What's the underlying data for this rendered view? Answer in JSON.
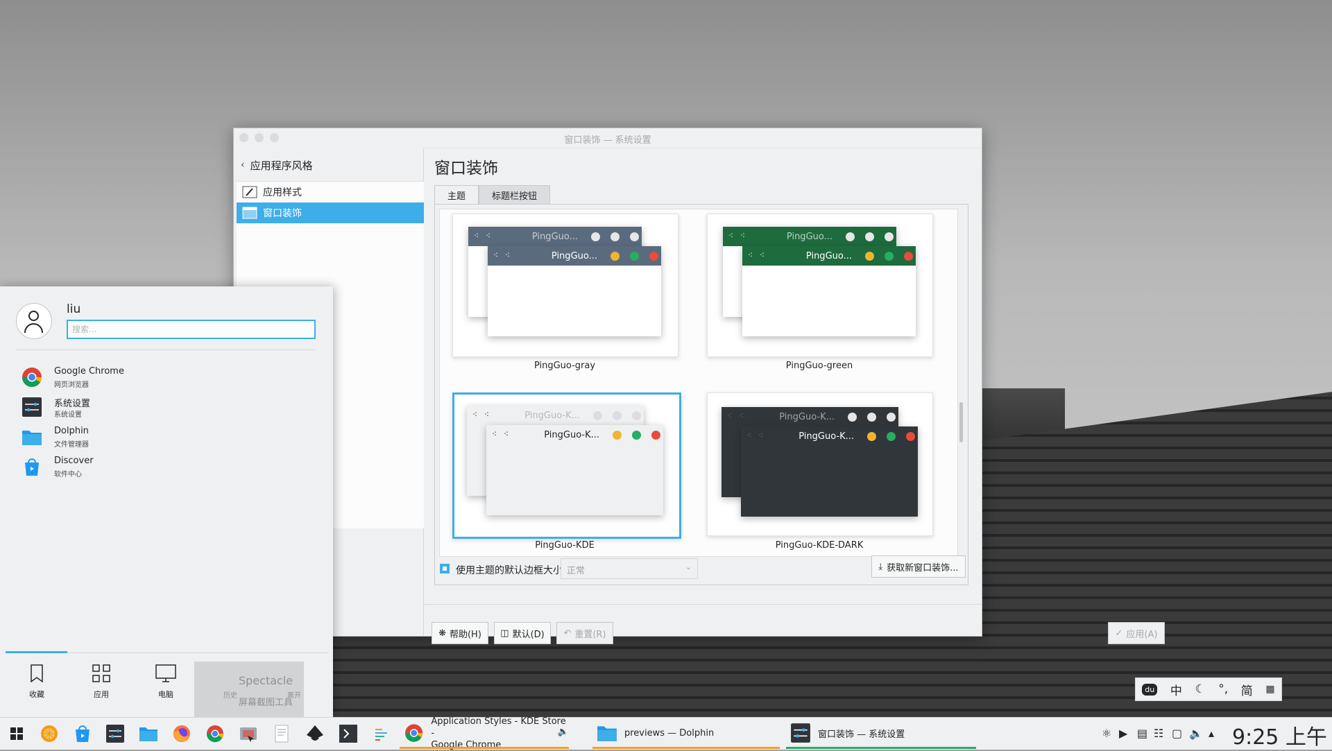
{
  "window": {
    "title": "窗口装饰 — 系统设置",
    "back_label": "应用程序风格",
    "sidebar_items": [
      {
        "label": "应用样式",
        "icon": "paintbrush-icon"
      },
      {
        "label": "窗口装饰",
        "icon": "window-icon"
      }
    ],
    "heading": "窗口装饰",
    "tabs": [
      "主题",
      "标题栏按钮"
    ],
    "themes": [
      {
        "name": "PingGuo-gray",
        "title": "PingGuo...",
        "bar_color": "#5b6b7e",
        "selected": false
      },
      {
        "name": "PingGuo-green",
        "title": "PingGuo...",
        "bar_color": "#1e6b3e",
        "selected": false
      },
      {
        "name": "PingGuo-KDE",
        "title": "PingGuo-K...",
        "bar_color": "#eff0f1",
        "selected": true
      },
      {
        "name": "PingGuo-KDE-DARK",
        "title": "PingGuo-K...",
        "bar_color": "#31363b",
        "selected": false
      }
    ],
    "use_default_border_label": "使用主题的默认边框大小",
    "border_size_value": "正常",
    "get_new_label": "获取新窗口装饰...",
    "buttons": {
      "help": "帮助(H)",
      "defaults": "默认(D)",
      "reset": "重置(R)",
      "apply": "应用(A)"
    }
  },
  "launcher": {
    "user": "liu",
    "search_placeholder": "搜索...",
    "apps": [
      {
        "name": "Google Chrome",
        "desc": "网页浏览器",
        "icon": "chrome-icon"
      },
      {
        "name": "系统设置",
        "desc": "系统设置",
        "icon": "system-settings-icon"
      },
      {
        "name": "Dolphin",
        "desc": "文件管理器",
        "icon": "dolphin-folder-icon"
      },
      {
        "name": "Discover",
        "desc": "软件中心",
        "icon": "discover-icon"
      }
    ],
    "nav": [
      "收藏",
      "应用",
      "电脑",
      "历史",
      "离开"
    ],
    "spectacle": {
      "name": "Spectacle",
      "desc": "屏幕截图工具"
    }
  },
  "ime": [
    "中",
    "简"
  ],
  "taskbar": {
    "tasks": [
      {
        "label_line1": "Application Styles - KDE Store -",
        "label_line2": "Google Chrome"
      },
      {
        "label_line1": "previews — Dolphin",
        "label_line2": ""
      },
      {
        "label_line1": "窗口装饰 — 系统设置",
        "label_line2": ""
      }
    ],
    "clock": "9:25 上午"
  },
  "colors": {
    "accent": "#3daee9",
    "close": "#e74c3c",
    "minimize": "#f1b52d",
    "maximize": "#27ae60"
  }
}
